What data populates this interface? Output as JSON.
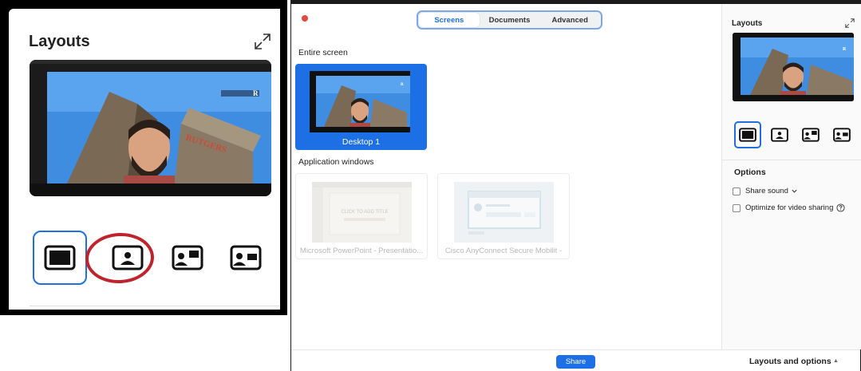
{
  "zoom_panel": {
    "title": "Layouts",
    "layouts": [
      "standard-layout-icon",
      "picture-in-picture-layout-icon",
      "side-by-side-layout-icon",
      "presenter-layout-icon"
    ],
    "selected_layout": 0,
    "highlighted_layout": 1,
    "colors": {
      "selection": "#1f6fe0",
      "annotation_circle": "#c0232c"
    }
  },
  "dialog": {
    "tabs": [
      {
        "label": "Screens",
        "active": true
      },
      {
        "label": "Documents",
        "active": false
      },
      {
        "label": "Advanced",
        "active": false
      }
    ],
    "entire_screen_label": "Entire screen",
    "desktop_tile": {
      "name": "Desktop 1",
      "selected": true
    },
    "application_windows_label": "Application windows",
    "app_tiles": [
      {
        "name": "Microsoft PowerPoint - Presentatio...",
        "thumb_text": "CLICK TO ADD TITLE"
      },
      {
        "name": "Cisco AnyConnect Secure Mobilit -"
      }
    ]
  },
  "sidebar": {
    "title": "Layouts",
    "selected_layout": 0,
    "options_title": "Options",
    "options": [
      {
        "label": "Share sound",
        "checked": false,
        "has_dropdown": true
      },
      {
        "label": "Optimize for video sharing",
        "checked": false,
        "has_help": true
      }
    ]
  },
  "bottom_bar": {
    "share_label": "Share",
    "layouts_options_label": "Layouts and options",
    "caret": "▲"
  },
  "colors": {
    "accent": "#1d6fe6",
    "close_dot": "#e3473f"
  }
}
